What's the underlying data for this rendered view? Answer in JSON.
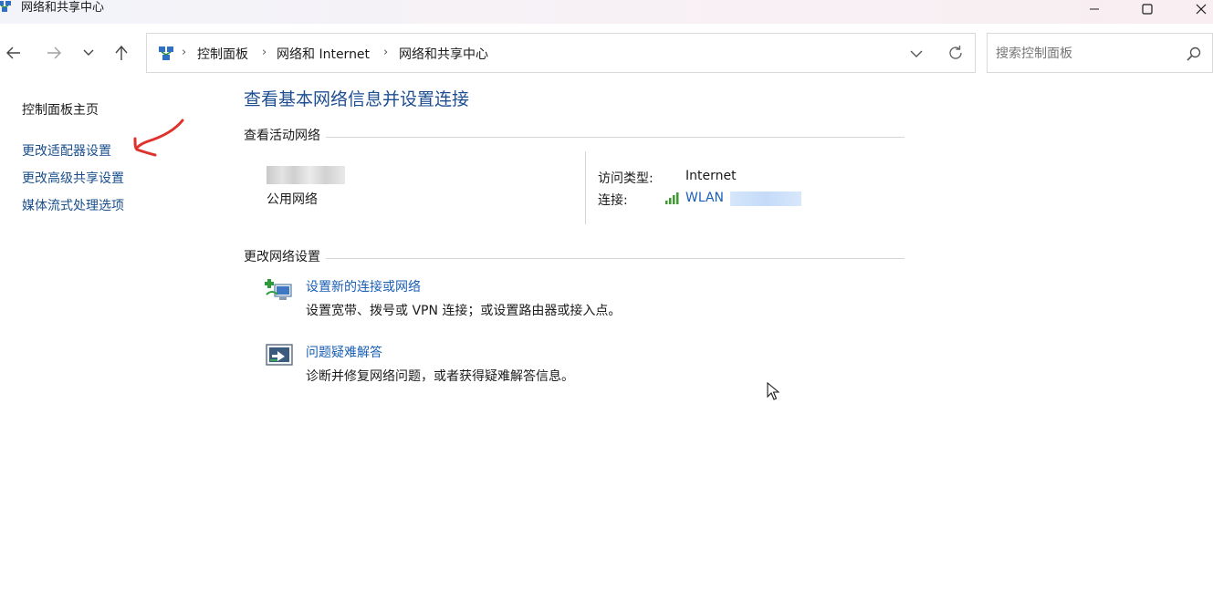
{
  "window": {
    "title": "网络和共享中心",
    "minimize_icon": "minimize-icon",
    "maximize_icon": "maximize-icon",
    "close_icon": "close-icon"
  },
  "nav": {
    "back_icon": "arrow-left-icon",
    "forward_icon": "arrow-right-icon",
    "recent_icon": "chevron-down-icon",
    "up_icon": "arrow-up-icon"
  },
  "address": {
    "breadcrumb": [
      "控制面板",
      "网络和 Internet",
      "网络和共享中心"
    ],
    "separator": "›",
    "dropdown_icon": "chevron-down-icon",
    "refresh_icon": "refresh-icon"
  },
  "search": {
    "placeholder": "搜索控制面板",
    "icon": "search-icon"
  },
  "sidebar": {
    "home": "控制面板主页",
    "items": [
      "更改适配器设置",
      "更改高级共享设置",
      "媒体流式处理选项"
    ]
  },
  "main": {
    "title": "查看基本网络信息并设置连接",
    "active_networks": {
      "heading": "查看活动网络",
      "network_type": "公用网络",
      "access_type_label": "访问类型:",
      "access_type_value": "Internet",
      "connection_label": "连接:",
      "connection_value": "WLAN"
    },
    "change_settings": {
      "heading": "更改网络设置",
      "tasks": [
        {
          "link": "设置新的连接或网络",
          "desc": "设置宽带、拨号或 VPN 连接；或设置路由器或接入点。",
          "icon": "new-connection-icon"
        },
        {
          "link": "问题疑难解答",
          "desc": "诊断并修复网络问题，或者获得疑难解答信息。",
          "icon": "troubleshoot-icon"
        }
      ]
    }
  },
  "colors": {
    "link": "#1a5fb4",
    "title_blue": "#1e4e92",
    "annotation_red": "#e0322c"
  }
}
